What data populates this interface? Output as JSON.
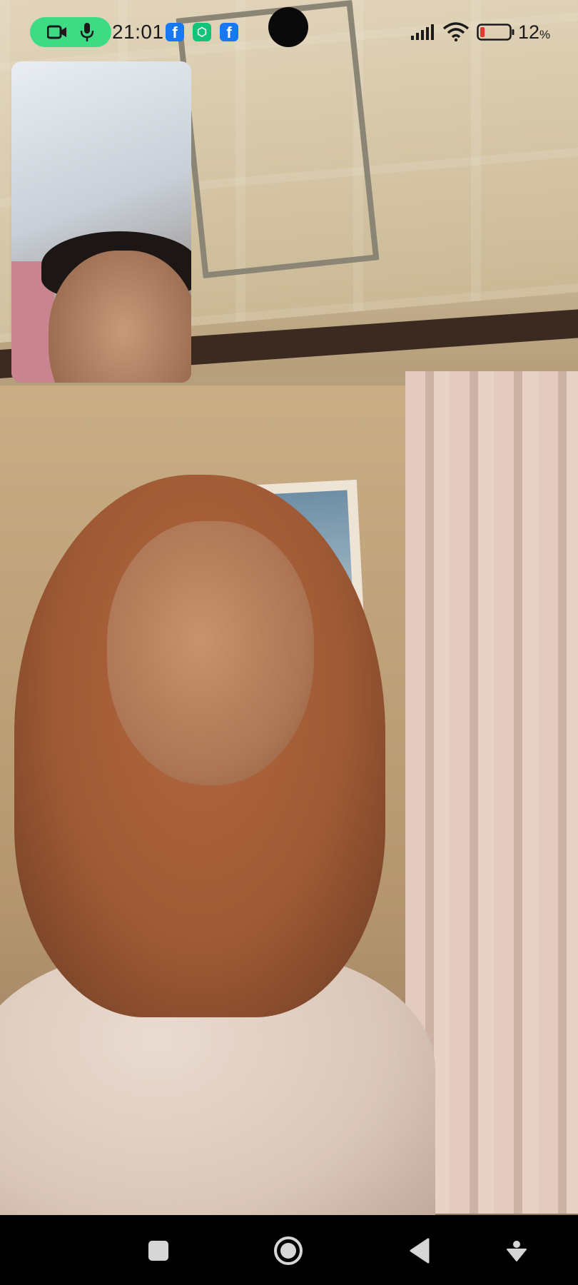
{
  "status_bar": {
    "time": "21:01",
    "battery_percent": "12",
    "battery_unit": "%",
    "battery_level": 0.12,
    "call_pill_color": "#3ddc84",
    "call_pill_icons": [
      "video-camera-icon",
      "microphone-icon"
    ],
    "notification_icons": [
      "facebook-icon",
      "green-app-icon",
      "facebook-icon"
    ],
    "notification_glyphs": [
      "f",
      "⬡",
      "f"
    ],
    "signal_icon": "cellular-signal-icon",
    "wifi_icon": "wifi-icon"
  },
  "call": {
    "remote_video": "remote-participant-video",
    "self_preview": "self-camera-preview"
  },
  "nav_bar": {
    "buttons": [
      "recents-square-icon",
      "home-circle-icon",
      "back-triangle-icon",
      "assistant-down-icon"
    ]
  }
}
